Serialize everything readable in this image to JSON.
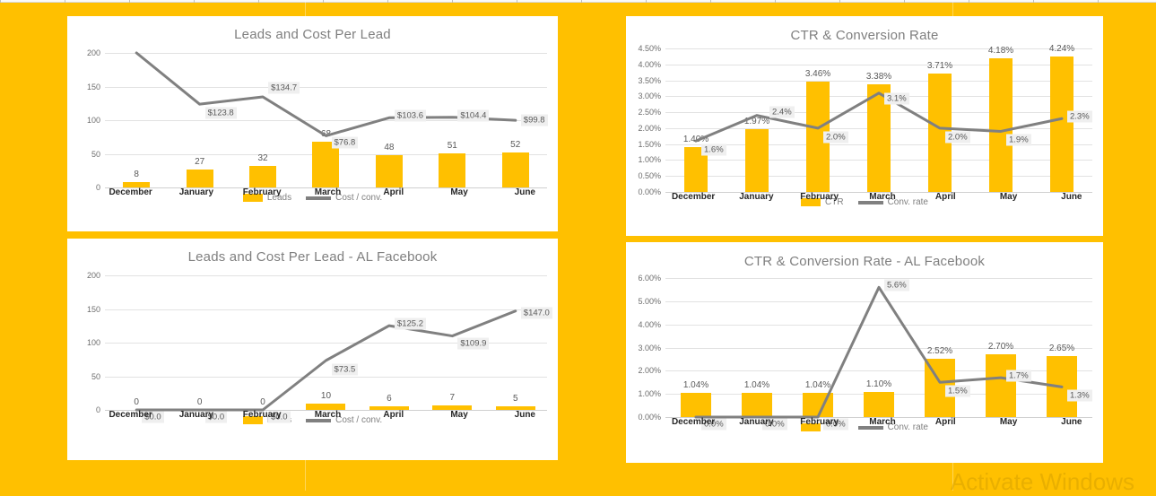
{
  "background_color": "#FFC000",
  "accent_color": "#FFC000",
  "line_color": "#808080",
  "title_color": "#7F7F7F",
  "watermark": "Activate Windows",
  "legend": {
    "leads_label": "Leads",
    "cost_label": "Cost / conv.",
    "ctr_label": "CTR",
    "conv_label": "Conv. rate"
  },
  "chart_data": [
    {
      "id": "leads_cost_per_lead",
      "type": "bar",
      "title": "Leads and Cost Per Lead",
      "categories": [
        "December",
        "January",
        "February",
        "March",
        "April",
        "May",
        "June"
      ],
      "ylabel": "",
      "xlabel": "",
      "ylim": [
        0,
        200
      ],
      "yticks": [
        "0",
        "50",
        "100",
        "150",
        "200"
      ],
      "ytick_values": [
        0,
        50,
        100,
        150,
        200
      ],
      "grid": true,
      "legend_position": "bottom",
      "series": [
        {
          "name": "Leads",
          "chart_type": "bar",
          "color": "#FFC000",
          "values": [
            8,
            27,
            32,
            68,
            48,
            51,
            52
          ],
          "labels": [
            "8",
            "27",
            "32",
            "68",
            "48",
            "51",
            "52"
          ]
        },
        {
          "name": "Cost / conv.",
          "chart_type": "line",
          "color": "#808080",
          "values": [
            200,
            123.8,
            134.7,
            76.8,
            103.6,
            104.4,
            99.8
          ],
          "labels": [
            "",
            "$123.8",
            "$134.7",
            "$76.8",
            "$103.6",
            "$104.4",
            "$99.8"
          ]
        }
      ]
    },
    {
      "id": "ctr_conversion_rate",
      "type": "bar",
      "title": "CTR & Conversion Rate",
      "categories": [
        "December",
        "January",
        "February",
        "March",
        "April",
        "May",
        "June"
      ],
      "ylabel": "",
      "xlabel": "",
      "ylim": [
        0,
        4.5
      ],
      "yticks": [
        "0.00%",
        "0.50%",
        "1.00%",
        "1.50%",
        "2.00%",
        "2.50%",
        "3.00%",
        "3.50%",
        "4.00%",
        "4.50%"
      ],
      "ytick_values": [
        0,
        0.5,
        1.0,
        1.5,
        2.0,
        2.5,
        3.0,
        3.5,
        4.0,
        4.5
      ],
      "grid": true,
      "legend_position": "bottom",
      "series": [
        {
          "name": "CTR",
          "chart_type": "bar",
          "color": "#FFC000",
          "values": [
            1.4,
            1.97,
            3.46,
            3.38,
            3.71,
            4.18,
            4.24
          ],
          "labels": [
            "1.40%",
            "1.97%",
            "3.46%",
            "3.38%",
            "3.71%",
            "4.18%",
            "4.24%"
          ]
        },
        {
          "name": "Conv. rate",
          "chart_type": "line",
          "color": "#808080",
          "values": [
            1.6,
            2.4,
            2.0,
            3.1,
            2.0,
            1.9,
            2.3
          ],
          "labels": [
            "1.6%",
            "2.4%",
            "2.0%",
            "3.1%",
            "2.0%",
            "1.9%",
            "2.3%"
          ]
        }
      ]
    },
    {
      "id": "leads_cost_per_lead_al_facebook",
      "type": "bar",
      "title": "Leads and Cost Per Lead - AL Facebook",
      "categories": [
        "December",
        "January",
        "February",
        "March",
        "April",
        "May",
        "June"
      ],
      "ylabel": "",
      "xlabel": "",
      "ylim": [
        0,
        200
      ],
      "yticks": [
        "0",
        "50",
        "100",
        "150",
        "200"
      ],
      "ytick_values": [
        0,
        50,
        100,
        150,
        200
      ],
      "grid": true,
      "legend_position": "bottom",
      "series": [
        {
          "name": "Leads",
          "chart_type": "bar",
          "color": "#FFC000",
          "values": [
            0,
            0,
            0,
            10,
            6,
            7,
            5
          ],
          "labels": [
            "0",
            "0",
            "0",
            "10",
            "6",
            "7",
            "5"
          ]
        },
        {
          "name": "Cost / conv.",
          "chart_type": "line",
          "color": "#808080",
          "values": [
            0,
            0,
            0,
            73.5,
            125.2,
            109.9,
            147.0
          ],
          "labels": [
            "$0.0",
            "$0.0",
            "$0.0",
            "$73.5",
            "$125.2",
            "$109.9",
            "$147.0"
          ]
        }
      ]
    },
    {
      "id": "ctr_conversion_rate_al_facebook",
      "type": "bar",
      "title": "CTR & Conversion Rate - AL Facebook",
      "categories": [
        "December",
        "January",
        "February",
        "March",
        "April",
        "May",
        "June"
      ],
      "ylabel": "",
      "xlabel": "",
      "ylim": [
        0,
        6.0
      ],
      "yticks": [
        "0.00%",
        "1.00%",
        "2.00%",
        "3.00%",
        "4.00%",
        "5.00%",
        "6.00%"
      ],
      "ytick_values": [
        0,
        1,
        2,
        3,
        4,
        5,
        6
      ],
      "grid": true,
      "legend_position": "bottom",
      "series": [
        {
          "name": "CTR",
          "chart_type": "bar",
          "color": "#FFC000",
          "values": [
            1.04,
            1.04,
            1.04,
            1.1,
            2.52,
            2.7,
            2.65
          ],
          "labels": [
            "1.04%",
            "1.04%",
            "1.04%",
            "1.10%",
            "2.52%",
            "2.70%",
            "2.65%"
          ]
        },
        {
          "name": "Conv. rate",
          "chart_type": "line",
          "color": "#808080",
          "values": [
            0.0,
            0.0,
            0.0,
            5.6,
            1.5,
            1.7,
            1.3
          ],
          "labels": [
            "0.0%",
            "0.0%",
            "0.0%",
            "5.6%",
            "1.5%",
            "1.7%",
            "1.3%"
          ]
        }
      ]
    }
  ]
}
